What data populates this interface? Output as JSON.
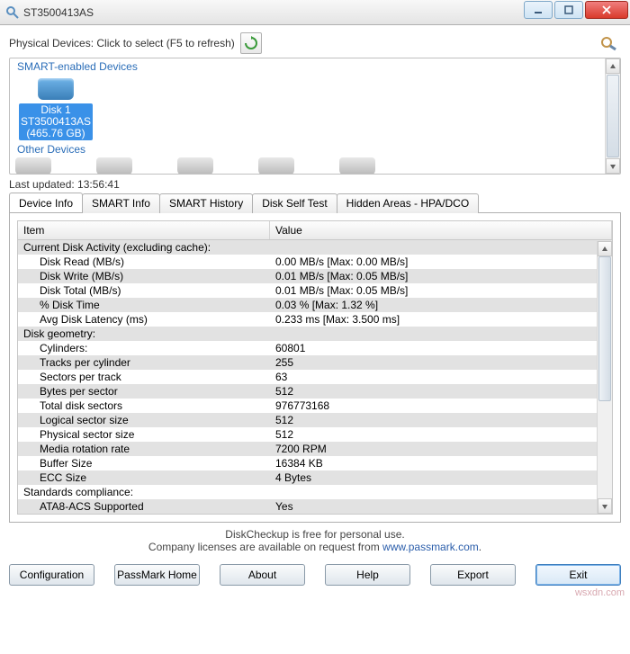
{
  "window": {
    "title": "ST3500413AS"
  },
  "topbar": {
    "label": "Physical Devices: Click to select (F5 to refresh)"
  },
  "device_panel": {
    "smart_caption": "SMART-enabled Devices",
    "other_caption": "Other Devices",
    "selected": {
      "line1": "Disk 1",
      "line2": "ST3500413AS",
      "line3": "(465.76 GB)"
    }
  },
  "last_updated": "Last updated: 13:56:41",
  "tabs": [
    "Device Info",
    "SMART Info",
    "SMART History",
    "Disk Self Test",
    "Hidden Areas - HPA/DCO"
  ],
  "grid": {
    "headers": {
      "item": "Item",
      "value": "Value"
    },
    "rows": [
      {
        "group": true,
        "item": "Current Disk Activity (excluding cache):",
        "value": "",
        "alt": true
      },
      {
        "item": "Disk Read (MB/s)",
        "value": "0.00 MB/s  [Max: 0.00 MB/s]",
        "alt": false
      },
      {
        "item": "Disk Write (MB/s)",
        "value": "0.01 MB/s  [Max: 0.05 MB/s]",
        "alt": true
      },
      {
        "item": "Disk Total (MB/s)",
        "value": "0.01 MB/s  [Max: 0.05 MB/s]",
        "alt": false
      },
      {
        "item": "% Disk Time",
        "value": "0.03 %     [Max: 1.32 %]",
        "alt": true
      },
      {
        "item": "Avg Disk Latency (ms)",
        "value": "0.233 ms   [Max: 3.500 ms]",
        "alt": false
      },
      {
        "group": true,
        "item": "Disk geometry:",
        "value": "",
        "alt": true
      },
      {
        "item": "Cylinders:",
        "value": "60801",
        "alt": false
      },
      {
        "item": "Tracks per cylinder",
        "value": "255",
        "alt": true
      },
      {
        "item": "Sectors per track",
        "value": "63",
        "alt": false
      },
      {
        "item": "Bytes per sector",
        "value": "512",
        "alt": true
      },
      {
        "item": "Total disk sectors",
        "value": "976773168",
        "alt": false
      },
      {
        "item": "Logical sector size",
        "value": "512",
        "alt": true
      },
      {
        "item": "Physical sector size",
        "value": "512",
        "alt": false
      },
      {
        "item": "Media rotation rate",
        "value": "7200 RPM",
        "alt": true
      },
      {
        "item": "Buffer Size",
        "value": "16384 KB",
        "alt": false
      },
      {
        "item": "ECC Size",
        "value": "4 Bytes",
        "alt": true
      },
      {
        "group": true,
        "item": "Standards compliance:",
        "value": "",
        "alt": false
      },
      {
        "item": "ATA8-ACS Supported",
        "value": "Yes",
        "alt": true
      }
    ]
  },
  "footer": {
    "line1": "DiskCheckup is free for personal use.",
    "line2_a": "Company licenses are available on request from ",
    "line2_b": "www.passmark.com",
    "line2_c": "."
  },
  "buttons": {
    "configuration": "Configuration",
    "passmark_home": "PassMark Home",
    "about": "About",
    "help": "Help",
    "export": "Export",
    "exit": "Exit"
  },
  "watermark": "wsxdn.com"
}
